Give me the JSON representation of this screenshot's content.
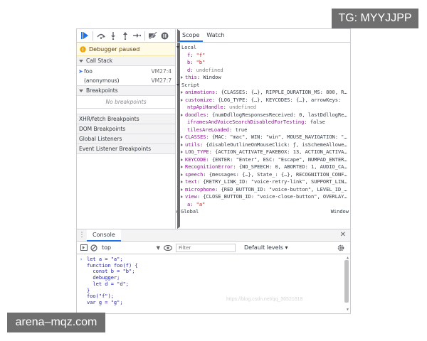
{
  "watermarks": {
    "top_right": "TG: MYYJJPP",
    "bottom_left": "arena–mqz.com"
  },
  "debugger": {
    "toolbar_icons": [
      "resume-icon",
      "step-over-icon",
      "step-into-icon",
      "step-out-icon",
      "step-icon",
      "deactivate-breakpoints-icon",
      "pause-on-exceptions-icon"
    ],
    "paused_message": "Debugger paused",
    "call_stack": {
      "title": "Call Stack",
      "frames": [
        {
          "name": "foo",
          "location": "VM27:4",
          "current": true
        },
        {
          "name": "(anonymous)",
          "location": "VM27:7",
          "current": false
        }
      ]
    },
    "breakpoints": {
      "title": "Breakpoints",
      "empty": "No breakpoints"
    },
    "collapsed_panes": [
      "XHR/fetch Breakpoints",
      "DOM Breakpoints",
      "Global Listeners",
      "Event Listener Breakpoints"
    ]
  },
  "scope": {
    "tabs": [
      "Scope",
      "Watch"
    ],
    "local_title": "Local",
    "local": [
      {
        "key": "f",
        "value": "\"f\"",
        "kind": "string"
      },
      {
        "key": "b",
        "value": "\"b\"",
        "kind": "string"
      },
      {
        "key": "d",
        "value": "undefined",
        "kind": "gray"
      },
      {
        "key": "this",
        "value": "Window",
        "kind": "plain",
        "expandable": true
      }
    ],
    "script_title": "Script",
    "script": [
      {
        "key": "animations",
        "value": "{CLASSES: {…}, RIPPLE_DURATION_MS: 800, R…",
        "expandable": true
      },
      {
        "key": "customize",
        "value": "{LOG_TYPE: {…}, KEYCODES: {…}, arrowKeys:",
        "expandable": true
      },
      {
        "key": "ntpApiHandle",
        "value": "undefined",
        "kind": "gray",
        "expandable": false
      },
      {
        "key": "doodles",
        "value": "{numDdllogResponsesReceived: 0, lastDdllogRe…",
        "expandable": true
      },
      {
        "key": "iframesAndVoiceSearchDisabledForTesting",
        "value": "false",
        "kind": "plain",
        "expandable": false
      },
      {
        "key": "tilesAreLoaded",
        "value": "true",
        "kind": "plain",
        "expandable": false
      },
      {
        "key": "CLASSES",
        "value": "{MAC: \"mac\", WIN: \"win\", MOUSE_NAVIGATION: \"…",
        "expandable": true
      },
      {
        "key": "utils",
        "value": "{disableOutlineOnMouseClick: ƒ, isSchemeAllowe…",
        "expandable": true
      },
      {
        "key": "LOG_TYPE",
        "value": "{ACTION_ACTIVATE_FAKEBOX: 13, ACTION_ACTIVA…",
        "expandable": true
      },
      {
        "key": "KEYCODE",
        "value": "{ENTER: \"Enter\", ESC: \"Escape\", NUMPAD_ENTER…",
        "expandable": true
      },
      {
        "key": "RecognitionError",
        "value": "{NO_SPEECH: 0, ABORTED: 1, AUDIO_CA…",
        "expandable": true
      },
      {
        "key": "speech",
        "value": "{messages: {…}, State_: {…}, RECOGNITION_CONF…",
        "expandable": true
      },
      {
        "key": "text",
        "value": "{RETRY_LINK_ID: \"voice-retry-link\", SUPPORT_LIN…",
        "expandable": true
      },
      {
        "key": "microphone",
        "value": "{RED_BUTTON_ID: \"voice-button\", LEVEL_ID_…",
        "expandable": true
      },
      {
        "key": "view",
        "value": "{CLOSE_BUTTON_ID: \"voice-close-button\", OVERLAY…",
        "expandable": true
      },
      {
        "key": "a",
        "value": "\"a\"",
        "kind": "string",
        "expandable": false
      }
    ],
    "global_title": "Global",
    "global_value": "Window"
  },
  "console": {
    "tab_label": "Console",
    "context": "top",
    "filter_placeholder": "Filter",
    "levels": "Default levels ▾",
    "code_lines": [
      "let a = \"a\";",
      "function foo(f) {",
      "  const b = \"b\";",
      "  debugger;",
      "  let d = \"d\";",
      "}",
      "foo(\"f\");",
      "var g = \"g\";"
    ],
    "faint_watermark": "https://blog.csdn.net/qq_36521618"
  }
}
